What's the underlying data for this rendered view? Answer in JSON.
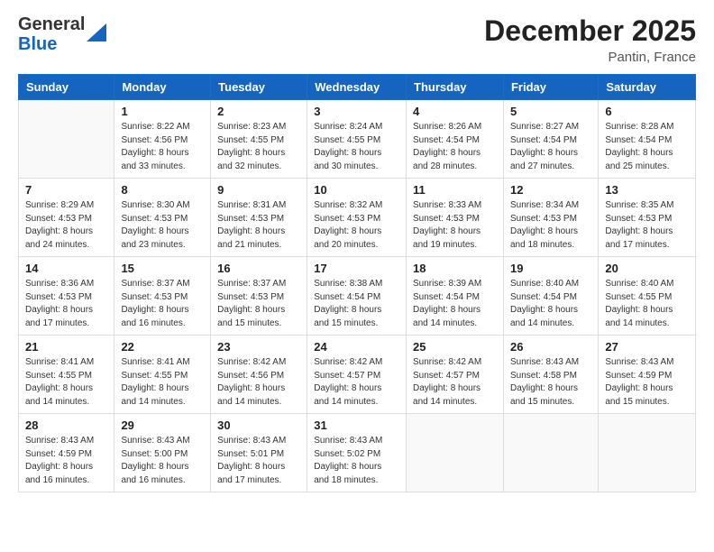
{
  "header": {
    "logo_general": "General",
    "logo_blue": "Blue",
    "month_year": "December 2025",
    "location": "Pantin, France"
  },
  "days_of_week": [
    "Sunday",
    "Monday",
    "Tuesday",
    "Wednesday",
    "Thursday",
    "Friday",
    "Saturday"
  ],
  "weeks": [
    [
      {
        "day": "",
        "info": ""
      },
      {
        "day": "1",
        "info": "Sunrise: 8:22 AM\nSunset: 4:56 PM\nDaylight: 8 hours\nand 33 minutes."
      },
      {
        "day": "2",
        "info": "Sunrise: 8:23 AM\nSunset: 4:55 PM\nDaylight: 8 hours\nand 32 minutes."
      },
      {
        "day": "3",
        "info": "Sunrise: 8:24 AM\nSunset: 4:55 PM\nDaylight: 8 hours\nand 30 minutes."
      },
      {
        "day": "4",
        "info": "Sunrise: 8:26 AM\nSunset: 4:54 PM\nDaylight: 8 hours\nand 28 minutes."
      },
      {
        "day": "5",
        "info": "Sunrise: 8:27 AM\nSunset: 4:54 PM\nDaylight: 8 hours\nand 27 minutes."
      },
      {
        "day": "6",
        "info": "Sunrise: 8:28 AM\nSunset: 4:54 PM\nDaylight: 8 hours\nand 25 minutes."
      }
    ],
    [
      {
        "day": "7",
        "info": "Sunrise: 8:29 AM\nSunset: 4:53 PM\nDaylight: 8 hours\nand 24 minutes."
      },
      {
        "day": "8",
        "info": "Sunrise: 8:30 AM\nSunset: 4:53 PM\nDaylight: 8 hours\nand 23 minutes."
      },
      {
        "day": "9",
        "info": "Sunrise: 8:31 AM\nSunset: 4:53 PM\nDaylight: 8 hours\nand 21 minutes."
      },
      {
        "day": "10",
        "info": "Sunrise: 8:32 AM\nSunset: 4:53 PM\nDaylight: 8 hours\nand 20 minutes."
      },
      {
        "day": "11",
        "info": "Sunrise: 8:33 AM\nSunset: 4:53 PM\nDaylight: 8 hours\nand 19 minutes."
      },
      {
        "day": "12",
        "info": "Sunrise: 8:34 AM\nSunset: 4:53 PM\nDaylight: 8 hours\nand 18 minutes."
      },
      {
        "day": "13",
        "info": "Sunrise: 8:35 AM\nSunset: 4:53 PM\nDaylight: 8 hours\nand 17 minutes."
      }
    ],
    [
      {
        "day": "14",
        "info": "Sunrise: 8:36 AM\nSunset: 4:53 PM\nDaylight: 8 hours\nand 17 minutes."
      },
      {
        "day": "15",
        "info": "Sunrise: 8:37 AM\nSunset: 4:53 PM\nDaylight: 8 hours\nand 16 minutes."
      },
      {
        "day": "16",
        "info": "Sunrise: 8:37 AM\nSunset: 4:53 PM\nDaylight: 8 hours\nand 15 minutes."
      },
      {
        "day": "17",
        "info": "Sunrise: 8:38 AM\nSunset: 4:54 PM\nDaylight: 8 hours\nand 15 minutes."
      },
      {
        "day": "18",
        "info": "Sunrise: 8:39 AM\nSunset: 4:54 PM\nDaylight: 8 hours\nand 14 minutes."
      },
      {
        "day": "19",
        "info": "Sunrise: 8:40 AM\nSunset: 4:54 PM\nDaylight: 8 hours\nand 14 minutes."
      },
      {
        "day": "20",
        "info": "Sunrise: 8:40 AM\nSunset: 4:55 PM\nDaylight: 8 hours\nand 14 minutes."
      }
    ],
    [
      {
        "day": "21",
        "info": "Sunrise: 8:41 AM\nSunset: 4:55 PM\nDaylight: 8 hours\nand 14 minutes."
      },
      {
        "day": "22",
        "info": "Sunrise: 8:41 AM\nSunset: 4:55 PM\nDaylight: 8 hours\nand 14 minutes."
      },
      {
        "day": "23",
        "info": "Sunrise: 8:42 AM\nSunset: 4:56 PM\nDaylight: 8 hours\nand 14 minutes."
      },
      {
        "day": "24",
        "info": "Sunrise: 8:42 AM\nSunset: 4:57 PM\nDaylight: 8 hours\nand 14 minutes."
      },
      {
        "day": "25",
        "info": "Sunrise: 8:42 AM\nSunset: 4:57 PM\nDaylight: 8 hours\nand 14 minutes."
      },
      {
        "day": "26",
        "info": "Sunrise: 8:43 AM\nSunset: 4:58 PM\nDaylight: 8 hours\nand 15 minutes."
      },
      {
        "day": "27",
        "info": "Sunrise: 8:43 AM\nSunset: 4:59 PM\nDaylight: 8 hours\nand 15 minutes."
      }
    ],
    [
      {
        "day": "28",
        "info": "Sunrise: 8:43 AM\nSunset: 4:59 PM\nDaylight: 8 hours\nand 16 minutes."
      },
      {
        "day": "29",
        "info": "Sunrise: 8:43 AM\nSunset: 5:00 PM\nDaylight: 8 hours\nand 16 minutes."
      },
      {
        "day": "30",
        "info": "Sunrise: 8:43 AM\nSunset: 5:01 PM\nDaylight: 8 hours\nand 17 minutes."
      },
      {
        "day": "31",
        "info": "Sunrise: 8:43 AM\nSunset: 5:02 PM\nDaylight: 8 hours\nand 18 minutes."
      },
      {
        "day": "",
        "info": ""
      },
      {
        "day": "",
        "info": ""
      },
      {
        "day": "",
        "info": ""
      }
    ]
  ]
}
